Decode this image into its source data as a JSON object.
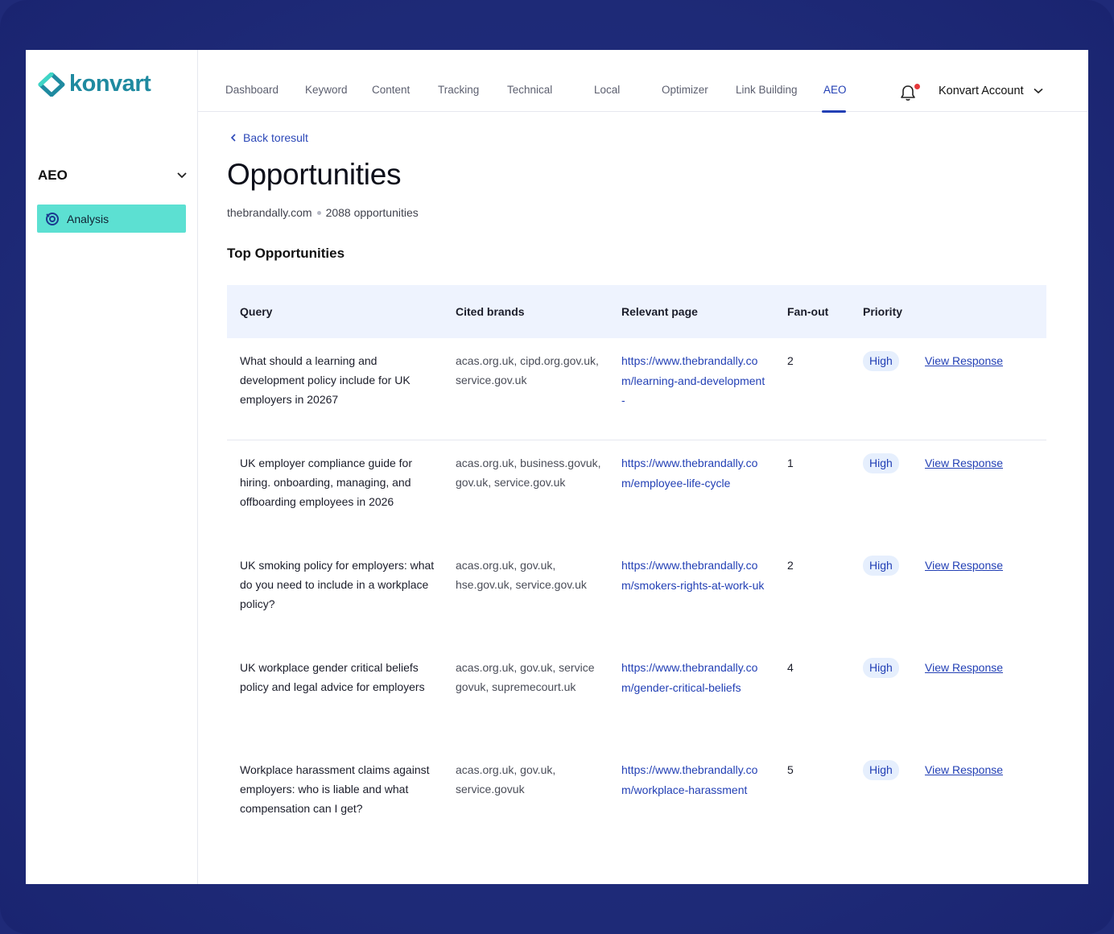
{
  "brand": {
    "name": "konvart"
  },
  "sidebar": {
    "section_title": "AEO",
    "items": [
      {
        "label": "Analysis"
      }
    ]
  },
  "nav": {
    "tabs": [
      "Dashboard",
      "Keyword",
      "Content",
      "Tracking",
      "Technical",
      "Local",
      "Optimizer",
      "Link Building",
      "AEO"
    ],
    "active": "AEO",
    "account_label": "Konvart Account"
  },
  "page": {
    "back_label": "Back toresult",
    "title": "Opportunities",
    "domain": "thebrandally.com",
    "count_label": "2088 opportunities",
    "section_title": "Top Opportunities"
  },
  "table": {
    "headers": {
      "query": "Query",
      "cited": "Cited brands",
      "page": "Relevant page",
      "fanout": "Fan-out",
      "priority": "Priority"
    },
    "rows": [
      {
        "query": "What should a learning and development policy include for UK employers in 20267",
        "cited": "acas.org.uk, cipd.org.gov.uk, service.gov.uk",
        "page": "https://www.thebrandally.com/learning-and-development-",
        "fanout": "2",
        "priority": "High",
        "action": "View Response"
      },
      {
        "query": "UK employer compliance guide for hiring. onboarding, managing, and offboarding employees in 2026",
        "cited": "acas.org.uk, business.govuk, gov.uk, service.gov.uk",
        "page": "https://www.thebrandally.com/employee-life-cycle",
        "fanout": "1",
        "priority": "High",
        "action": "View Response"
      },
      {
        "query": "UK smoking policy for employers: what do you need to include in a workplace policy?",
        "cited": "acas.org.uk, gov.uk, hse.gov.uk, service.gov.uk",
        "page": "https://www.thebrandally.com/smokers-rights-at-work-uk",
        "fanout": "2",
        "priority": "High",
        "action": "View Response"
      },
      {
        "query": "UK workplace gender critical beliefs policy and legal advice for employers",
        "cited": "acas.org.uk, gov.uk, service govuk, supremecourt.uk",
        "page": "https://www.thebrandally.com/gender-critical-beliefs",
        "fanout": "4",
        "priority": "High",
        "action": "View Response"
      },
      {
        "query": "Workplace harassment claims against employers: who is liable and what compensation can I get?",
        "cited": "acas.org.uk, gov.uk, service.govuk",
        "page": "https://www.thebrandally.com/workplace-harassment",
        "fanout": "5",
        "priority": "High",
        "action": "View Response"
      }
    ]
  },
  "colors": {
    "frame": "#1f2a78",
    "accent": "#2340b5",
    "sidebar_active": "#5ce0d2",
    "header_bg": "#eef3fe",
    "badge_bg": "#e6effd",
    "notification": "#e5383b"
  }
}
